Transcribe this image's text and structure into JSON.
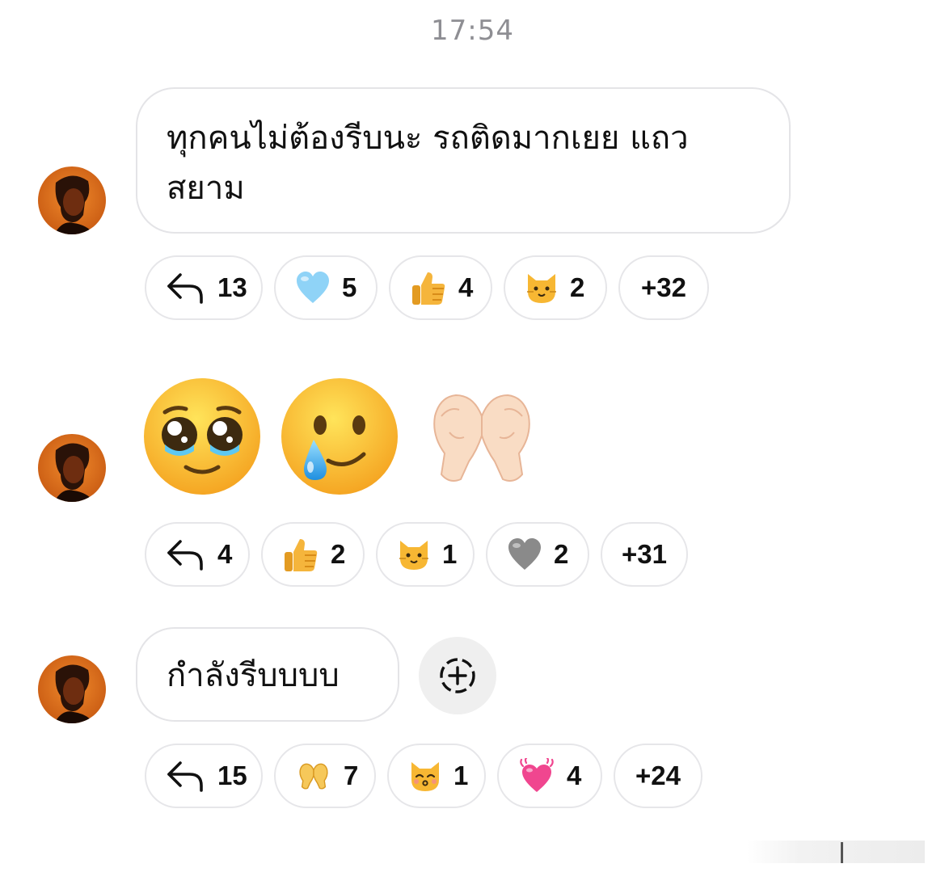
{
  "timestamp": "17:54",
  "messages": [
    {
      "text": "ทุกคนไม่ต้องรีบนะ รถติดมากเยย แถวสยาม",
      "reactions": {
        "reply_count": "13",
        "items": [
          {
            "icon": "light-blue-heart-icon",
            "count": "5"
          },
          {
            "icon": "thumbs-up-icon",
            "count": "4"
          },
          {
            "icon": "cat-face-icon",
            "count": "2"
          }
        ],
        "more": "+32"
      }
    },
    {
      "emojis": [
        "pleading-face-icon",
        "smiling-face-with-tear-icon",
        "heart-hands-icon"
      ],
      "reactions": {
        "reply_count": "4",
        "items": [
          {
            "icon": "thumbs-up-icon",
            "count": "2"
          },
          {
            "icon": "cat-face-icon",
            "count": "1"
          },
          {
            "icon": "grey-heart-icon",
            "count": "2"
          }
        ],
        "more": "+31"
      }
    },
    {
      "text": "กำลังรีบบบบ",
      "reactions": {
        "reply_count": "15",
        "items": [
          {
            "icon": "heart-hands-icon",
            "count": "7"
          },
          {
            "icon": "kissing-cat-icon",
            "count": "1"
          },
          {
            "icon": "beating-heart-icon",
            "count": "4"
          }
        ],
        "more": "+24"
      }
    }
  ],
  "colors": {
    "bubble_border": "#e4e4e7",
    "timestamp": "#8e8e93",
    "light_blue_heart": "#8fd3f7",
    "grey_heart": "#8a8a8a",
    "pink_heart": "#f0468f"
  }
}
